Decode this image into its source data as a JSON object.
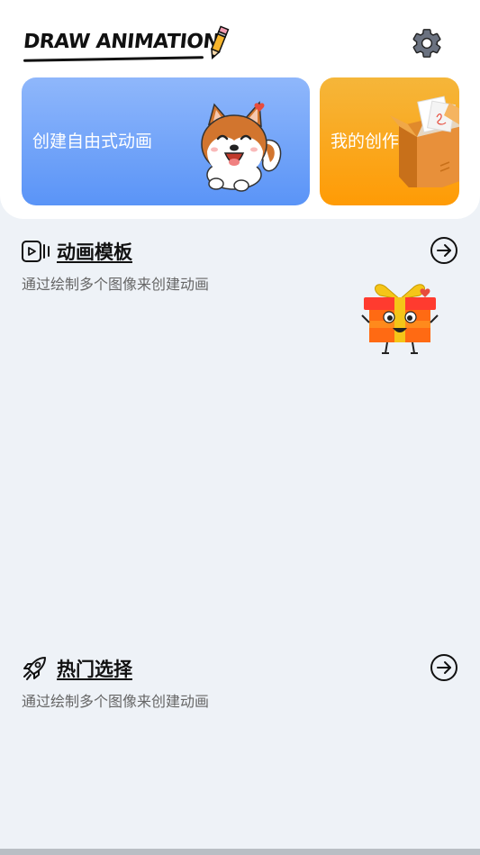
{
  "header": {
    "logo_text": "DRAW ANIMATION",
    "settings_icon": "gear-icon"
  },
  "cards": {
    "free_animation_label": "创建自由式动画",
    "my_creations_label": "我的创作"
  },
  "sections": {
    "templates": {
      "title": "动画模板",
      "subtitle": "通过绘制多个图像来创建动画",
      "icon": "video-icon"
    },
    "popular": {
      "title": "热门选择",
      "subtitle": "通过绘制多个图像来创建动画",
      "icon": "rocket-icon"
    }
  },
  "colors": {
    "blue_card": "#6fa2f8",
    "orange_card": "#ffa01a",
    "background": "#eef2f7"
  }
}
